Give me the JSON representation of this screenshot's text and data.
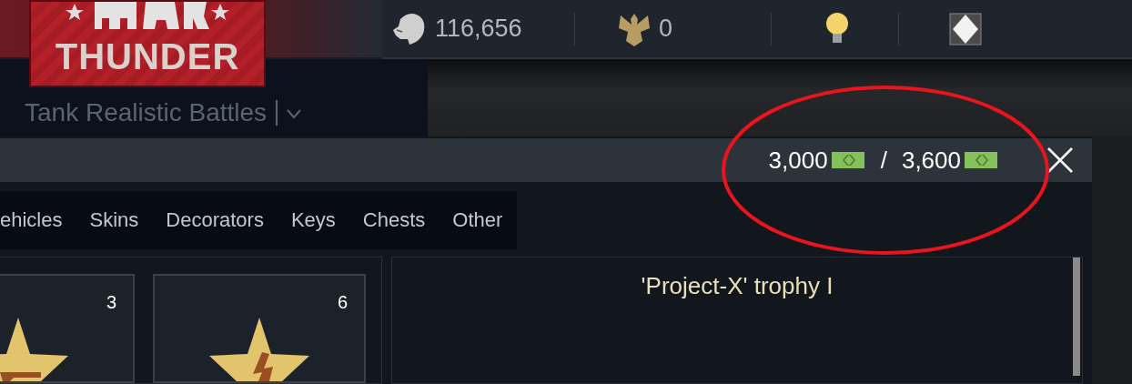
{
  "header": {
    "logo_text": "THUNDER",
    "currencies": [
      {
        "kind": "lion",
        "amount": "116,656"
      },
      {
        "kind": "eagle",
        "amount": "0"
      },
      {
        "kind": "bulb"
      },
      {
        "kind": "diamond"
      }
    ]
  },
  "game_mode": {
    "label": "Tank Realistic Battles"
  },
  "window": {
    "balance": "3,000",
    "separator": "/",
    "limit": "3,600"
  },
  "tabs": [
    {
      "label": "ehicles",
      "selected": false
    },
    {
      "label": "Skins",
      "selected": false
    },
    {
      "label": "Decorators",
      "selected": false
    },
    {
      "label": "Keys",
      "selected": false
    },
    {
      "label": "Chests",
      "selected": false
    },
    {
      "label": "Other",
      "selected": false
    }
  ],
  "items": [
    {
      "count": "3",
      "kind": "pistol"
    },
    {
      "count": "6",
      "kind": "bolt"
    }
  ],
  "detail": {
    "title": "'Project-X' trophy I"
  }
}
